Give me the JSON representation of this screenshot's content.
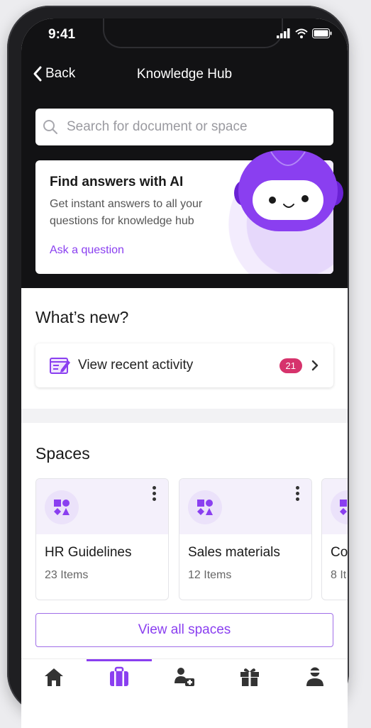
{
  "status_bar": {
    "time": "9:41"
  },
  "nav": {
    "back_label": "Back",
    "title": "Knowledge Hub"
  },
  "search": {
    "placeholder": "Search for document or space"
  },
  "ai_card": {
    "title": "Find answers with AI",
    "description": "Get instant answers to all your questions for knowledge hub",
    "link": "Ask a question"
  },
  "whats_new": {
    "title": "What’s new?",
    "activity_label": "View recent activity",
    "activity_count": "21"
  },
  "spaces": {
    "title": "Spaces",
    "items": [
      {
        "name": "HR Guidelines",
        "count": "23 Items"
      },
      {
        "name": "Sales materials",
        "count": "12 Items"
      },
      {
        "name": "Co",
        "count": "8 It"
      }
    ],
    "view_all_label": "View all spaces"
  },
  "tabbar": {
    "items": [
      {
        "icon": "home-icon"
      },
      {
        "icon": "briefcase-icon",
        "active": true
      },
      {
        "icon": "people-icon"
      },
      {
        "icon": "gift-icon"
      },
      {
        "icon": "profile-icon"
      }
    ]
  },
  "colors": {
    "accent": "#8a3ff0",
    "badge": "#d6336c",
    "dark_header": "#121214"
  }
}
